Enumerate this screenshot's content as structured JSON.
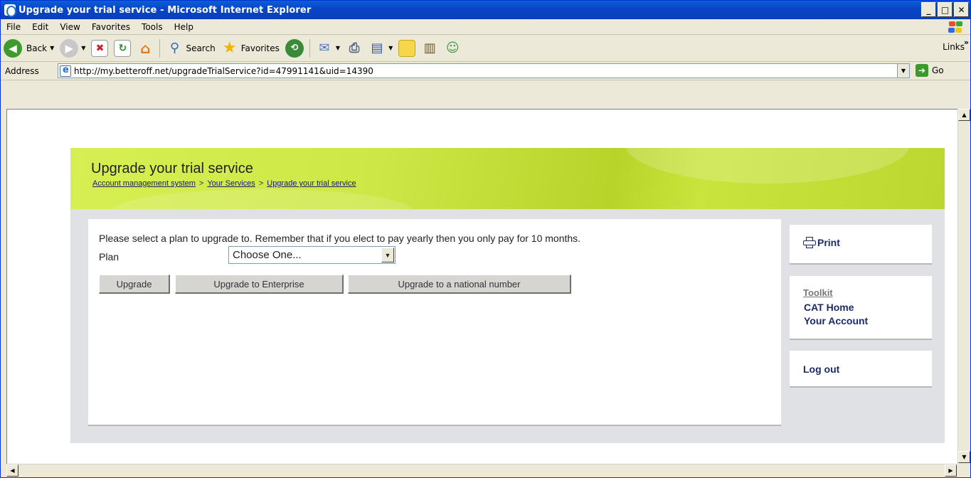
{
  "window": {
    "title": "Upgrade your trial service - Microsoft Internet Explorer"
  },
  "menu": {
    "items": [
      "File",
      "Edit",
      "View",
      "Favorites",
      "Tools",
      "Help"
    ]
  },
  "toolbar": {
    "back_label": "Back",
    "search_label": "Search",
    "favorites_label": "Favorites",
    "links_label": "Links"
  },
  "address": {
    "label": "Address",
    "url": "http://my.betteroff.net/upgradeTrialService?id=47991141&uid=14390",
    "go_label": "Go"
  },
  "page": {
    "title": "Upgrade your trial service",
    "breadcrumb": [
      "Account management system",
      "Your Services",
      "Upgrade your trial service"
    ],
    "intro": "Please select a plan to upgrade to. Remember that if you elect to pay yearly then you only pay for 10 months.",
    "plan_label": "Plan",
    "plan_selected": "Choose One...",
    "buttons": {
      "upgrade": "Upgrade",
      "enterprise": "Upgrade to Enterprise",
      "national": "Upgrade to a national number"
    },
    "sidebar": {
      "print": "Print",
      "toolkit_title": "Toolkit",
      "cat_home": "CAT Home",
      "your_account": "Your Account",
      "logout": "Log out"
    }
  },
  "colors": {
    "banner": "#cde846",
    "link_blue": "#1b2a6b",
    "titlebar": "#0846c8"
  }
}
